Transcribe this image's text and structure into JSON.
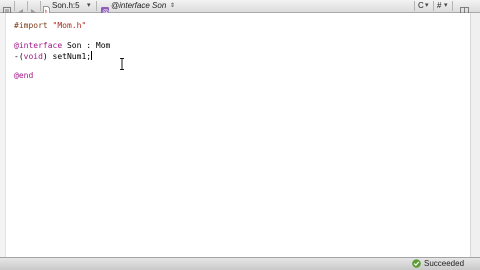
{
  "jump_bar": {
    "file_label": "Son.h:5",
    "symbol_label": "@interface Son",
    "language_label": "C",
    "counterparts_label": "#",
    "icons": [
      "related-items-icon",
      "back-arrow-icon",
      "forward-arrow-icon",
      "header-file-icon",
      "objc-class-icon"
    ]
  },
  "editor": {
    "line1_directive": "#import",
    "line1_string": "\"Mom.h\"",
    "line2_keyword": "@interface",
    "line2_rest": " Son : Mom",
    "line3_prefix": "-(",
    "line3_type": "void",
    "line3_rest": ") setNum1;",
    "line4_keyword": "@end"
  },
  "status": {
    "text": "Succeeded",
    "icon": "build-succeeded-check-icon"
  },
  "colors": {
    "directive": "#7b3d19",
    "string": "#b02a1e",
    "keyword": "#a0178a",
    "success_green": "#5a9e33"
  }
}
